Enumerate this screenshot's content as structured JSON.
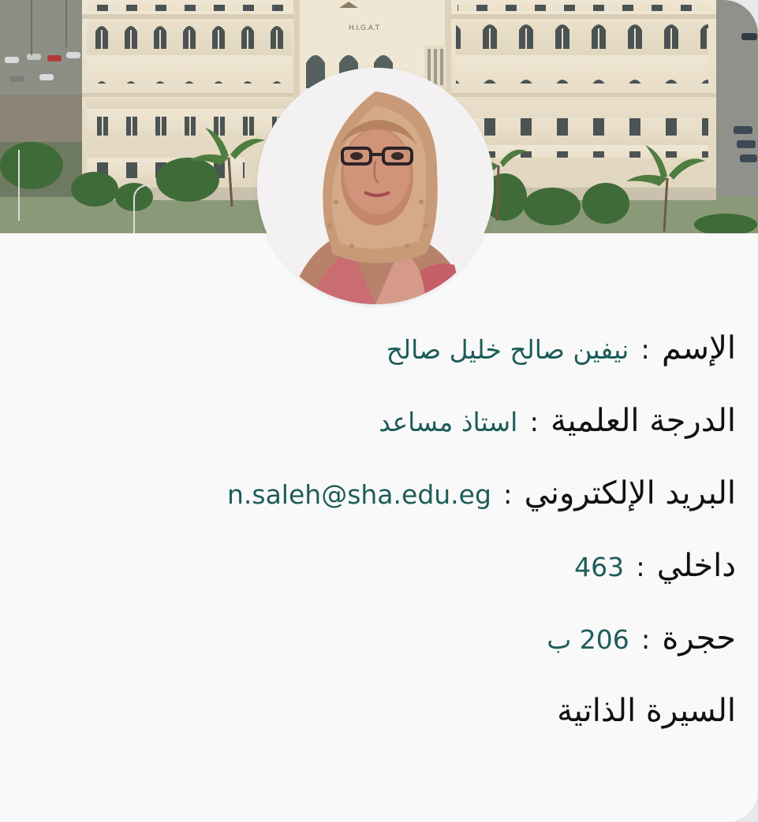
{
  "cover": {
    "building_sign": "H.I.G.A.T",
    "image": "campus-building-photo"
  },
  "avatar": {
    "image": "profile-photo"
  },
  "profile": {
    "name": {
      "label": "الإسم",
      "separator": ":",
      "value": "نيفين صالح خليل صالح"
    },
    "degree": {
      "label": "الدرجة العلمية",
      "separator": ":",
      "value": "استاذ مساعد"
    },
    "email": {
      "label": "البريد الإلكتروني",
      "separator": ":",
      "value": "n.saleh@sha.edu.eg"
    },
    "extension": {
      "label": "داخلي",
      "separator": ":",
      "value": "463"
    },
    "room": {
      "label": "حجرة",
      "separator": ":",
      "value": "206 ب"
    },
    "cv_link": "السيرة الذاتية"
  },
  "colors": {
    "value_text": "#1d5c5a",
    "label_text": "#111111",
    "card_background": "#f9f9f9"
  }
}
